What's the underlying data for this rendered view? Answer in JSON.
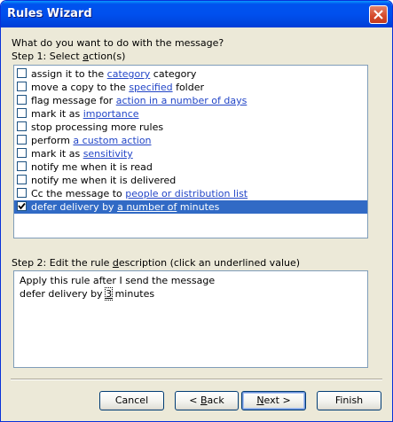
{
  "window": {
    "title": "Rules Wizard"
  },
  "question": "What do you want to do with the message?",
  "step1": {
    "label_pre": "Step 1: Select ",
    "label_ul": "a",
    "label_post": "ction(s)"
  },
  "actions": [
    {
      "pre": "assign it to the ",
      "link": "category",
      "post": " category",
      "checked": false
    },
    {
      "pre": "move a copy to the ",
      "link": "specified",
      "post": " folder",
      "checked": false
    },
    {
      "pre": "flag message for ",
      "link": "action in a number of days",
      "post": "",
      "checked": false
    },
    {
      "pre": "mark it as ",
      "link": "importance",
      "post": "",
      "checked": false
    },
    {
      "pre": "stop processing more rules",
      "link": "",
      "post": "",
      "checked": false
    },
    {
      "pre": "perform ",
      "link": "a custom action",
      "post": "",
      "checked": false
    },
    {
      "pre": "mark it as ",
      "link": "sensitivity",
      "post": "",
      "checked": false
    },
    {
      "pre": "notify me when it is read",
      "link": "",
      "post": "",
      "checked": false
    },
    {
      "pre": "notify me when it is delivered",
      "link": "",
      "post": "",
      "checked": false
    },
    {
      "pre": "Cc the message to ",
      "link": "people or distribution list",
      "post": "",
      "checked": false
    },
    {
      "pre": "defer delivery by ",
      "link": "a number of",
      "post": " minutes",
      "checked": true
    }
  ],
  "step2": {
    "label_pre": "Step 2: Edit the rule ",
    "label_ul": "d",
    "label_post": "escription (click an underlined value)"
  },
  "description": {
    "line1": "Apply this rule after I send the message",
    "line2_pre": "defer delivery by ",
    "line2_link": "3",
    "line2_post": " minutes"
  },
  "buttons": {
    "cancel": "Cancel",
    "back_pre": "< ",
    "back_ul": "B",
    "back_post": "ack",
    "next_ul": "N",
    "next_post": "ext >",
    "finish": "Finish"
  }
}
